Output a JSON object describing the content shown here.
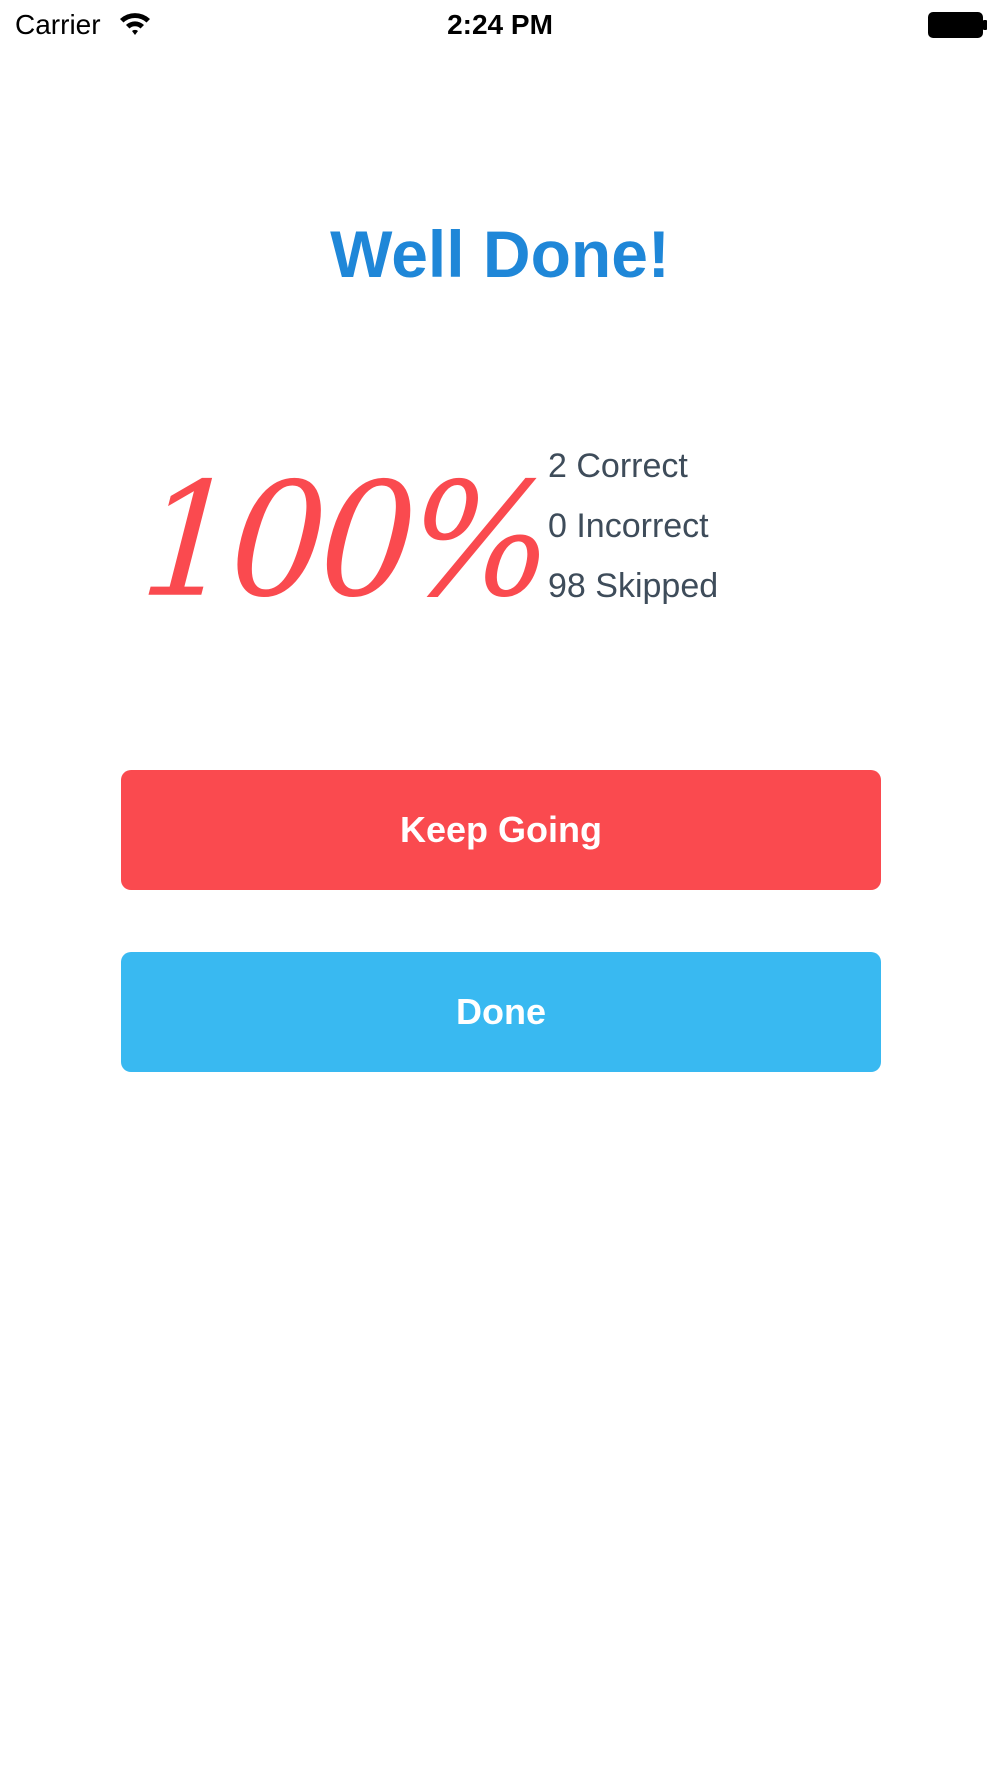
{
  "status_bar": {
    "carrier": "Carrier",
    "time": "2:24 PM",
    "wifi_icon": "wifi-icon",
    "battery_icon": "battery-icon"
  },
  "result": {
    "title": "Well Done!",
    "percentage": "100%",
    "correct": "2 Correct",
    "incorrect": "0 Incorrect",
    "skipped": "98 Skipped"
  },
  "actions": {
    "keep_going_label": "Keep Going",
    "done_label": "Done"
  },
  "colors": {
    "title": "#1f87d8",
    "accent_red": "#fa4a4f",
    "accent_blue": "#39b9f1",
    "stats_text": "#3e4c5a"
  }
}
